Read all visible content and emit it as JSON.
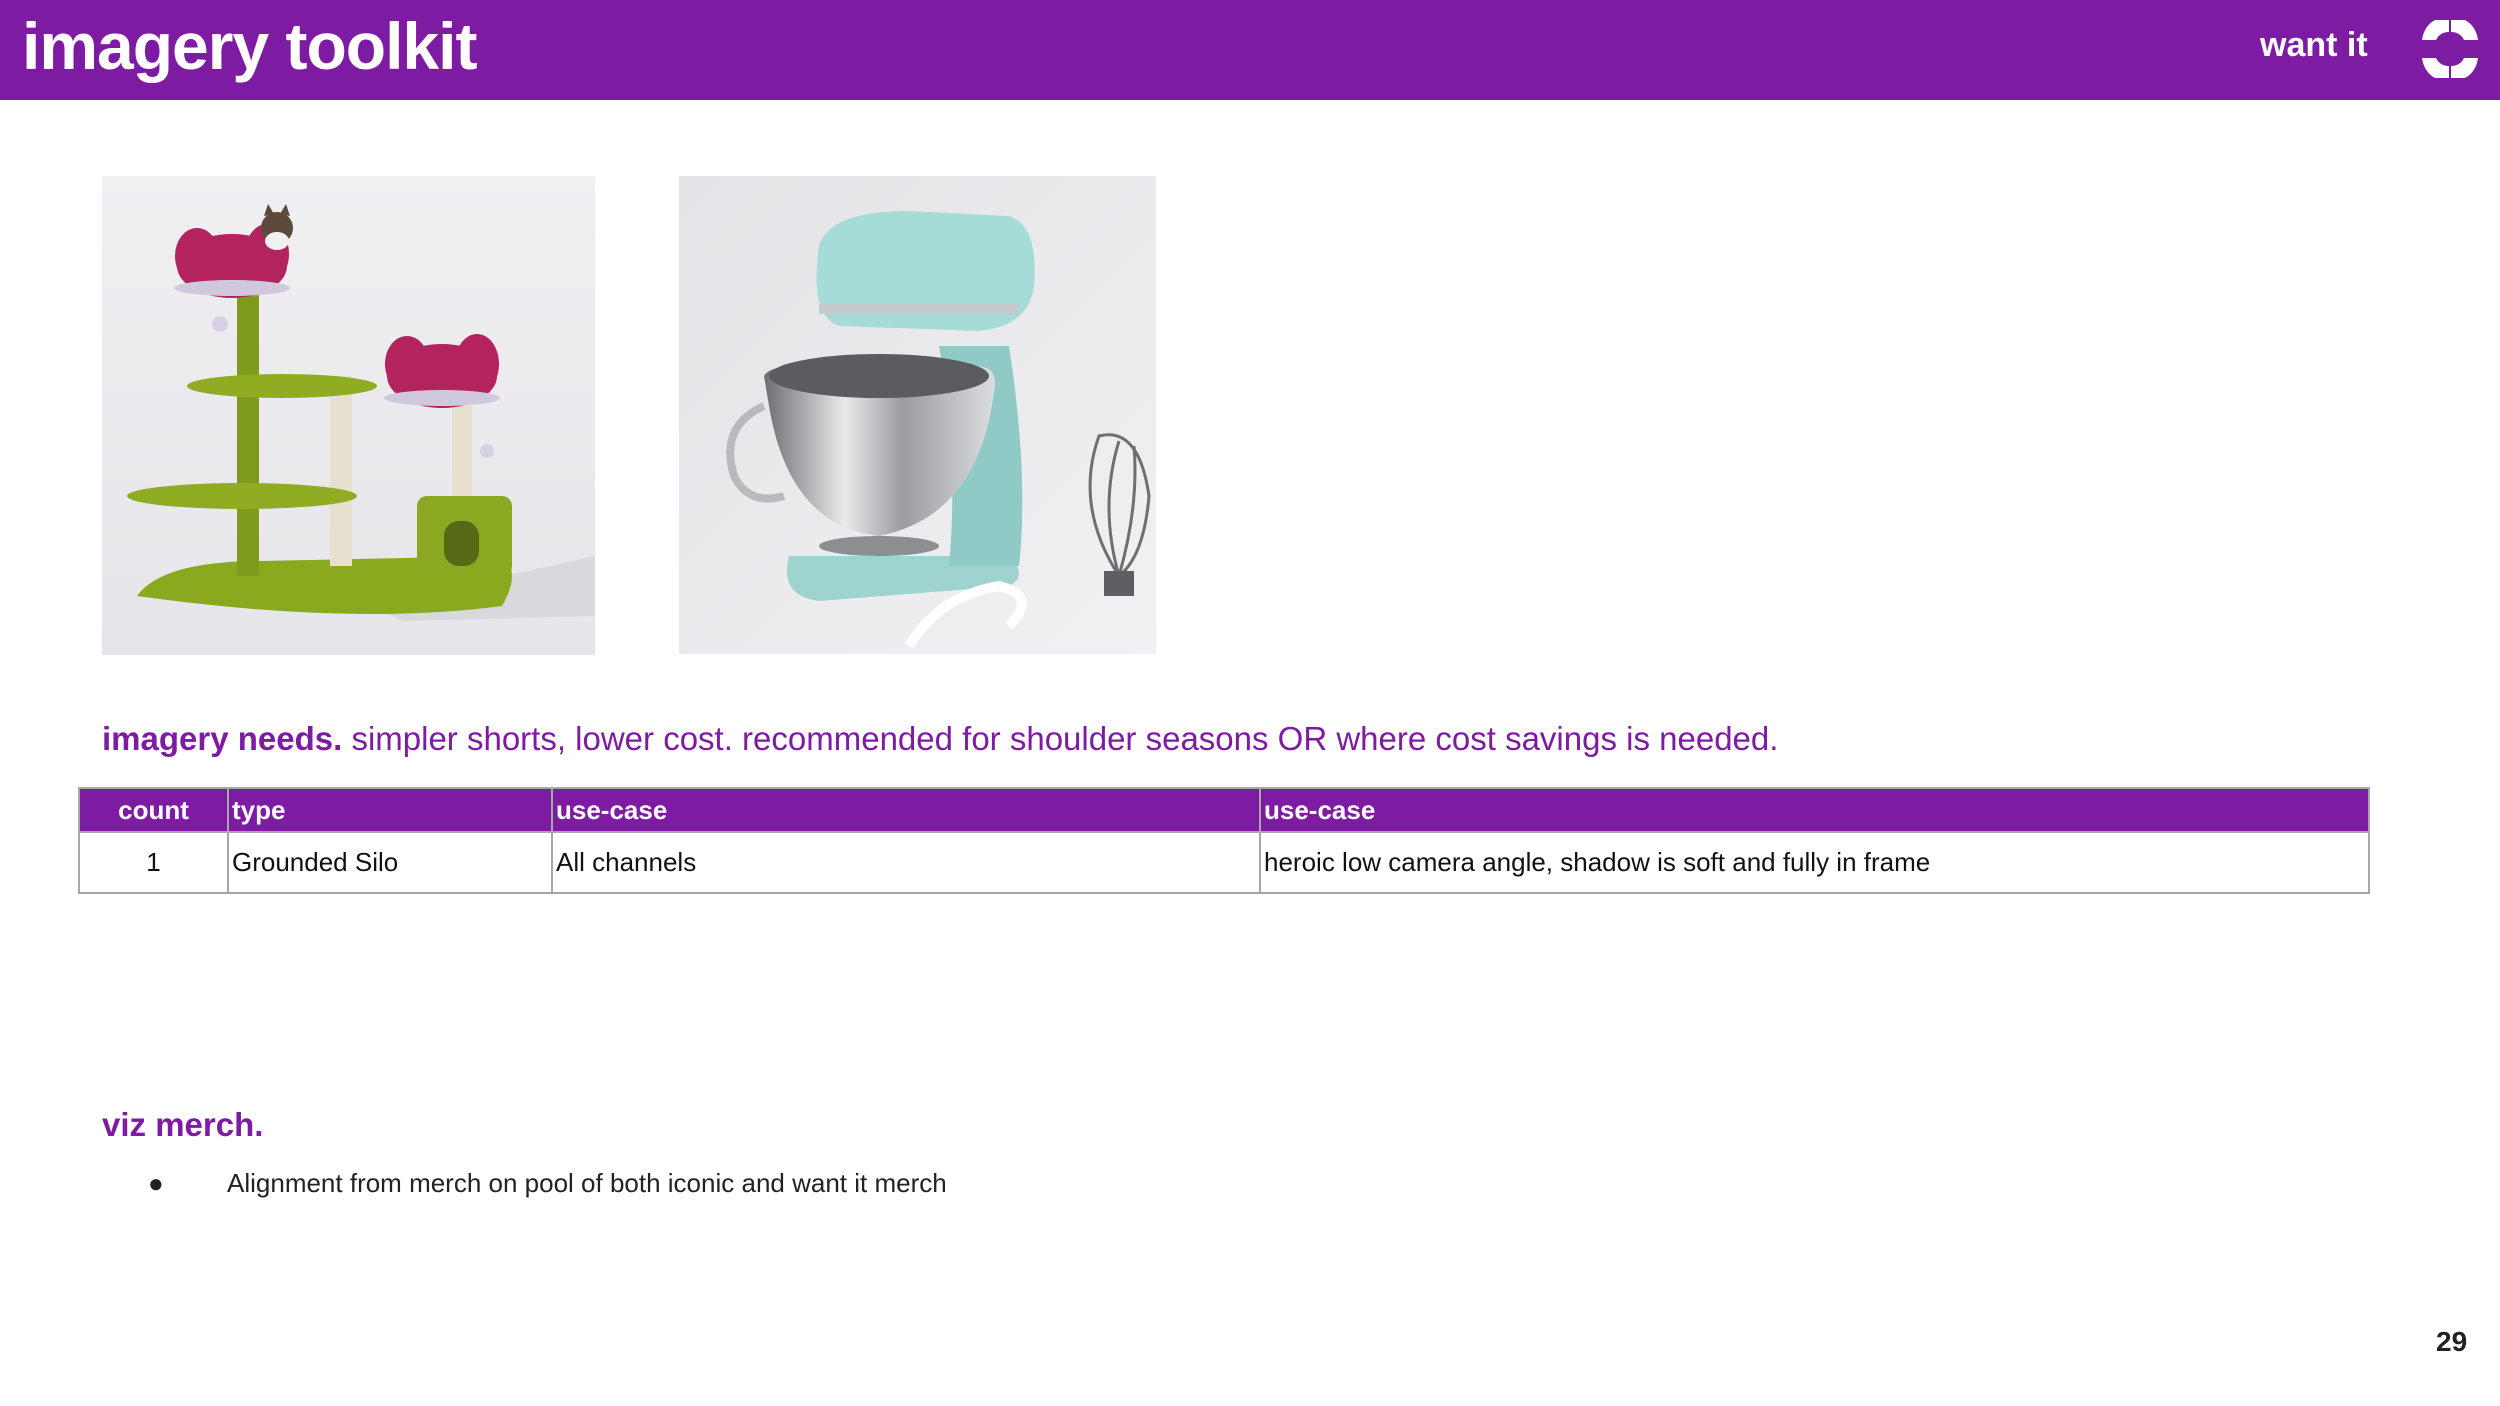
{
  "header": {
    "title": "imagery toolkit",
    "brand_text": "want it",
    "background_color": "#7e1ba3"
  },
  "photos": [
    {
      "name": "cat-tree-photo",
      "icon": "flower-cat-tree"
    },
    {
      "name": "stand-mixer-photo",
      "icon": "stand-mixer"
    }
  ],
  "needs": {
    "heading": "imagery needs.",
    "text": " simpler shorts, lower cost. recommended for shoulder seasons OR where cost savings is needed."
  },
  "table": {
    "headers": [
      "count",
      "type",
      "use-case",
      "use-case"
    ],
    "rows": [
      [
        "1",
        "Grounded Silo",
        "All channels",
        "heroic low camera angle, shadow is soft and fully in frame"
      ]
    ]
  },
  "viz_merch": {
    "heading": "viz merch.",
    "bullet_symbol": "●",
    "bullet": "Alignment from merch on pool of both iconic and want it merch"
  },
  "page_number": "29"
}
